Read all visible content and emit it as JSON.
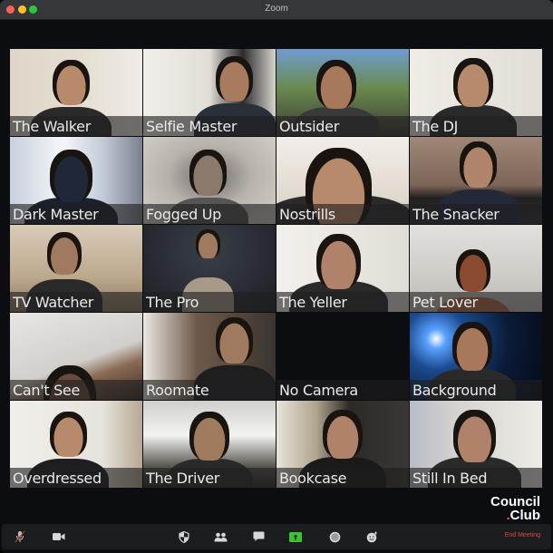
{
  "window": {
    "title": "Zoom",
    "controls": [
      "close",
      "minimize",
      "maximize"
    ]
  },
  "participants": [
    {
      "name": "The Walker",
      "bg": "#d9d2c4"
    },
    {
      "name": "Selfie Master",
      "bg": "#e4e1da"
    },
    {
      "name": "Outsider",
      "bg": "#5c7a4a"
    },
    {
      "name": "The DJ",
      "bg": "#e6e2db"
    },
    {
      "name": "Dark Master",
      "bg": "#9aa3b3"
    },
    {
      "name": "Fogged Up",
      "bg": "#c4bfb8"
    },
    {
      "name": "Nostrills",
      "bg": "#e8e2d8"
    },
    {
      "name": "The Snacker",
      "bg": "#8a7466"
    },
    {
      "name": "TV Watcher",
      "bg": "#cbbda8"
    },
    {
      "name": "The Pro",
      "bg": "#23262b"
    },
    {
      "name": "The Yeller",
      "bg": "#e9e5de"
    },
    {
      "name": "Pet Lover",
      "bg": "#d7d6d2"
    },
    {
      "name": "Can't See",
      "bg": "#d6d4d0"
    },
    {
      "name": "Roomate",
      "bg": "#7a6555"
    },
    {
      "name": "No Camera",
      "bg": "#0c0d10"
    },
    {
      "name": "Background",
      "bg": "#0d2346"
    },
    {
      "name": "Overdressed",
      "bg": "#e9e6df"
    },
    {
      "name": "The Driver",
      "bg": "#6f6d68"
    },
    {
      "name": "Bookcase",
      "bg": "#6a5a48"
    },
    {
      "name": "Still In Bed",
      "bg": "#d8d6d2"
    }
  ],
  "branding": {
    "line1": "Council",
    "line2_dot": ".",
    "line2": "Club",
    "accent": "#f05a22"
  },
  "toolbar": {
    "buttons": [
      {
        "id": "mute",
        "icon": "microphone-muted-icon"
      },
      {
        "id": "video",
        "icon": "video-camera-icon"
      },
      {
        "id": "security",
        "icon": "shield-icon"
      },
      {
        "id": "participants",
        "icon": "participants-icon"
      },
      {
        "id": "chat",
        "icon": "chat-bubble-icon"
      },
      {
        "id": "share-screen",
        "icon": "share-screen-icon"
      },
      {
        "id": "record",
        "icon": "record-icon"
      },
      {
        "id": "reactions",
        "icon": "reactions-icon"
      }
    ],
    "end_meeting_label": "End Meeting",
    "end_meeting_color": "#e0474c",
    "share_color": "#3cc232"
  }
}
